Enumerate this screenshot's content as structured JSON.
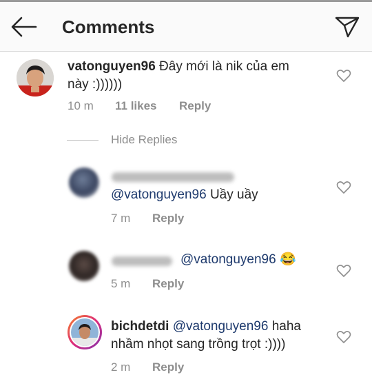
{
  "header": {
    "title": "Comments"
  },
  "comments": [
    {
      "username": "vatonguyen96",
      "text_line1": "Đây mới là nik của em",
      "text_line2": "này :))))))",
      "time": "10 m",
      "likes": "11 likes",
      "reply_label": "Reply"
    }
  ],
  "hide_replies_label": "Hide Replies",
  "replies": [
    {
      "mention": "@vatonguyen96",
      "text": "Uầy uầy",
      "time": "7 m",
      "reply_label": "Reply"
    },
    {
      "mention": "@vatonguyen96",
      "emoji": "😂",
      "time": "5 m",
      "reply_label": "Reply"
    },
    {
      "username": "bichdetdi",
      "mention": "@vatonguyen96",
      "text_line1": "haha",
      "text_line2": "nhầm nhọt sang trồng trọt :))))",
      "time": "2 m",
      "reply_label": "Reply"
    }
  ]
}
